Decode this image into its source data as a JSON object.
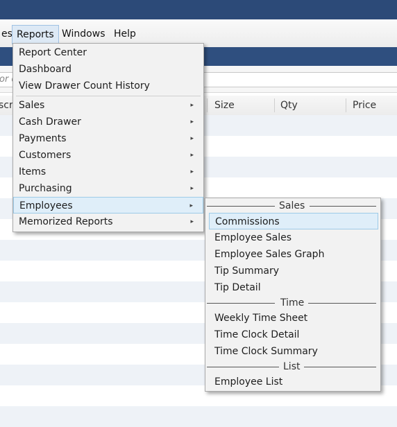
{
  "menubar": {
    "items": [
      {
        "label": "es"
      },
      {
        "label": "Reports"
      },
      {
        "label": "Windows"
      },
      {
        "label": "Help"
      }
    ]
  },
  "search": {
    "placeholder": "or d"
  },
  "grid": {
    "columns": [
      {
        "label": "scri"
      },
      {
        "label": "Size"
      },
      {
        "label": "Qty"
      },
      {
        "label": "Price"
      }
    ]
  },
  "reports_menu": {
    "top_items": [
      {
        "label": "Report Center"
      },
      {
        "label": "Dashboard"
      },
      {
        "label": "View Drawer Count History"
      }
    ],
    "sub_items": [
      {
        "label": "Sales"
      },
      {
        "label": "Cash Drawer"
      },
      {
        "label": "Payments"
      },
      {
        "label": "Customers"
      },
      {
        "label": "Items"
      },
      {
        "label": "Purchasing"
      },
      {
        "label": "Employees"
      },
      {
        "label": "Memorized Reports"
      }
    ],
    "submenu_arrow": "▸"
  },
  "employees_submenu": {
    "groups": [
      {
        "title": "Sales",
        "items": [
          {
            "label": "Commissions"
          },
          {
            "label": "Employee Sales"
          },
          {
            "label": "Employee Sales Graph"
          },
          {
            "label": "Tip Summary"
          },
          {
            "label": "Tip Detail"
          }
        ]
      },
      {
        "title": "Time",
        "items": [
          {
            "label": "Weekly Time Sheet"
          },
          {
            "label": "Time Clock Detail"
          },
          {
            "label": "Time Clock Summary"
          }
        ]
      },
      {
        "title": "List",
        "items": [
          {
            "label": "Employee List"
          }
        ]
      }
    ]
  },
  "colors": {
    "titlebar": "#2c4a78",
    "highlight": "#dfeef9",
    "highlight_border": "#9dcbe8",
    "row_alt": "#eef2f7"
  }
}
